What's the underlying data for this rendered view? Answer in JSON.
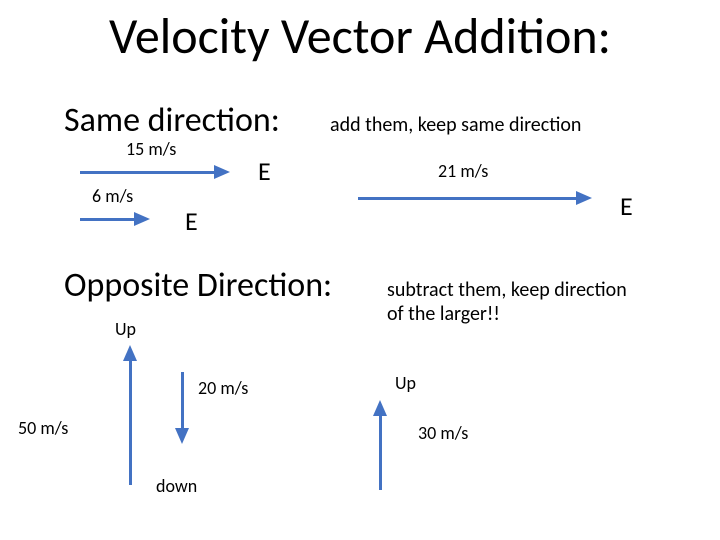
{
  "title": "Velocity Vector Addition:",
  "section1": {
    "heading": "Same direction:",
    "note": "add them, keep same direction",
    "v1": {
      "label": "15 m/s",
      "dir": "E"
    },
    "v2": {
      "label": "6 m/s",
      "dir": "E"
    },
    "result": {
      "label": "21 m/s",
      "dir": "E"
    }
  },
  "section2": {
    "heading": "Opposite Direction:",
    "note_line1": "subtract them, keep direction",
    "note_line2": "of the larger!!",
    "v1": {
      "label": "50 m/s",
      "dir": "Up"
    },
    "v2": {
      "label": "20 m/s",
      "dir": "down"
    },
    "result": {
      "label": "30 m/s",
      "dir": "Up"
    }
  },
  "colors": {
    "arrow": "#4372c3"
  }
}
